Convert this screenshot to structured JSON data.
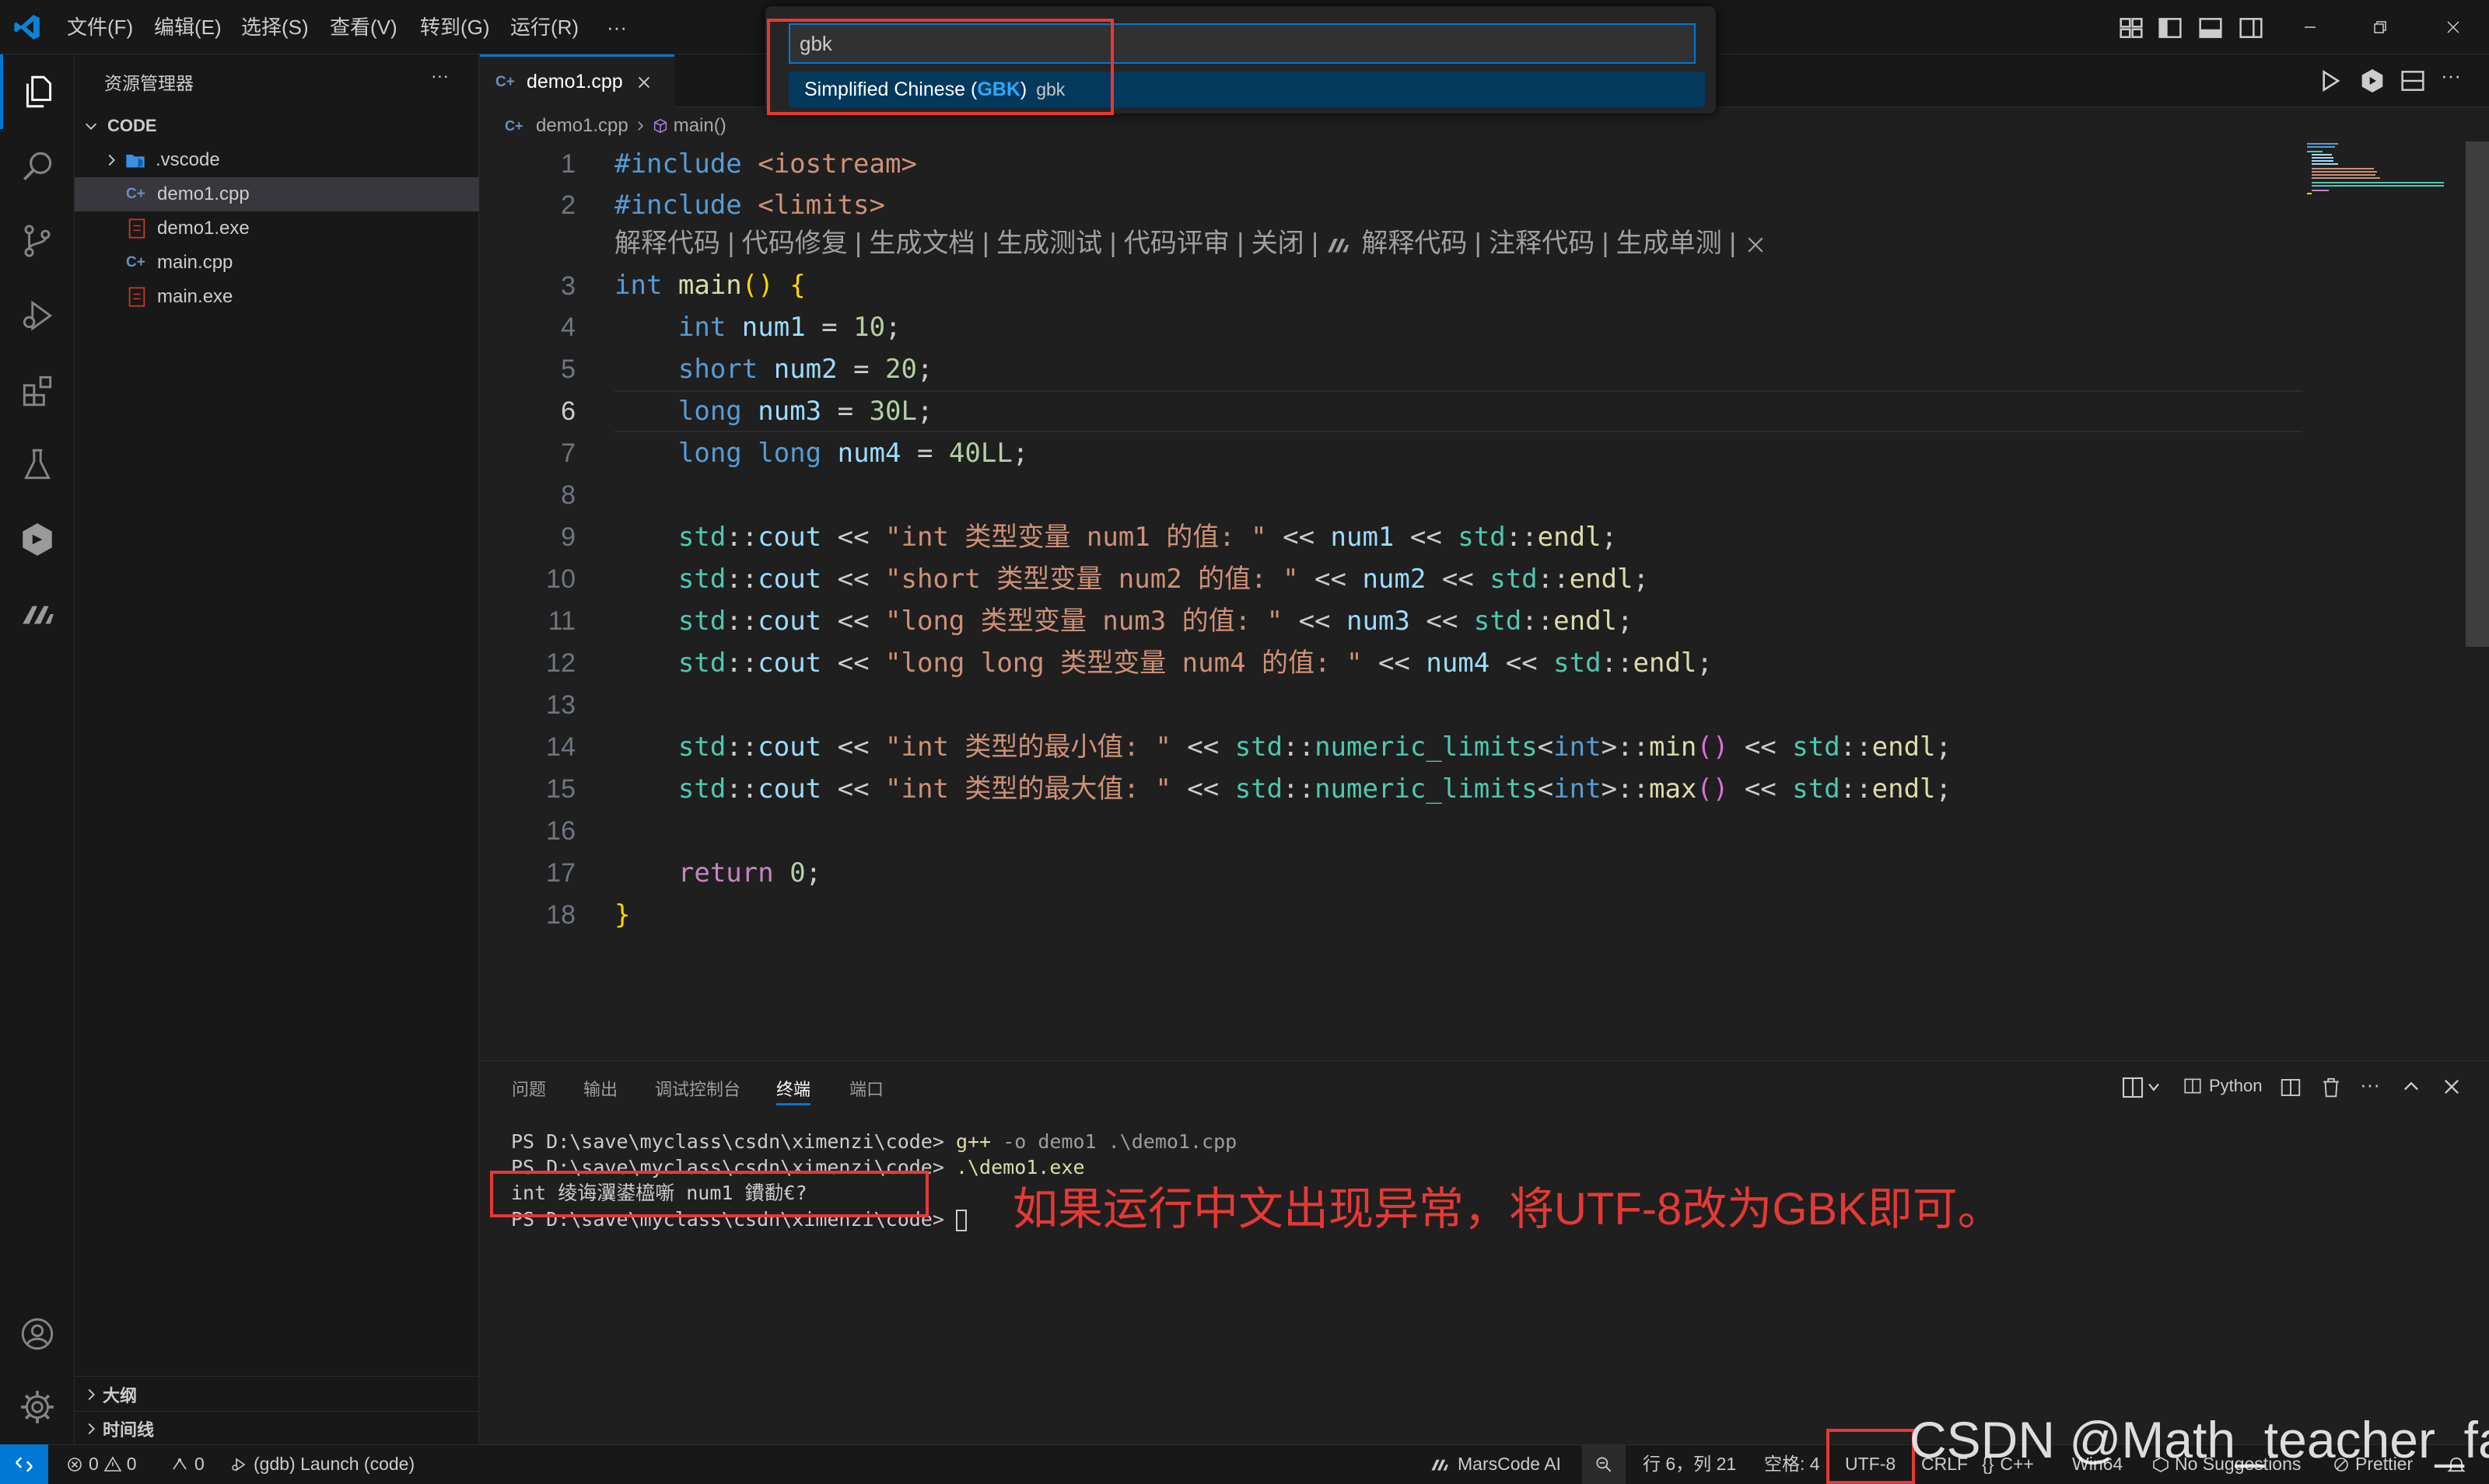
{
  "menu": [
    "文件(F)",
    "编辑(E)",
    "选择(S)",
    "查看(V)",
    "转到(G)",
    "运行(R)",
    "···"
  ],
  "quickpick": {
    "input_value": "gbk",
    "item_prefix": "Simplified Chinese (",
    "item_match": "GBK",
    "item_suffix": ")",
    "item_detail": "gbk"
  },
  "sidebar": {
    "title": "资源管理器",
    "more": "···",
    "folder": "CODE",
    "items": [
      ".vscode",
      "demo1.cpp",
      "demo1.exe",
      "main.cpp",
      "main.exe"
    ],
    "outline": "大纲",
    "timeline": "时间线"
  },
  "tab": {
    "label": "demo1.cpp"
  },
  "breadcrumbs": {
    "file": "demo1.cpp",
    "symbol": "main()"
  },
  "codelens": "解释代码 | 代码修复 | 生成文档 | 生成测试 | 代码评审 | 关闭 | ",
  "codelens2": "解释代码 | 注释代码 | 生成单测 | ",
  "line_numbers": [
    "1",
    "2",
    "3",
    "4",
    "5",
    "6",
    "7",
    "8",
    "9",
    "10",
    "11",
    "12",
    "13",
    "14",
    "15",
    "16",
    "17",
    "18"
  ],
  "panel": {
    "tabs": [
      "问题",
      "输出",
      "调试控制台",
      "终端",
      "端口"
    ],
    "python": "Python",
    "terminal": [
      {
        "prompt": "PS D:\\save\\myclass\\csdn\\ximenzi\\code> ",
        "cmd": "g++",
        "args": " -o demo1 .\\demo1.cpp"
      },
      {
        "prompt": "PS D:\\save\\myclass\\csdn\\ximenzi\\code> ",
        "cmd": ".\\demo1.exe",
        "args": ""
      },
      {
        "prompt": "int 绫诲瀷鍙橀噺 num1 鐨勫€?",
        "cmd": "",
        "args": ""
      },
      {
        "prompt": "PS D:\\save\\myclass\\csdn\\ximenzi\\code> ",
        "cmd": "",
        "args": ""
      }
    ]
  },
  "annotation": "如果运行中文出现异常，将UTF-8改为GBK即可。",
  "statusbar": {
    "errors": "0",
    "warnings": "0",
    "ports": "0",
    "launch": "(gdb) Launch (code)",
    "marscode": "MarsCode AI",
    "position": "行 6，列 21",
    "spaces": "空格: 4",
    "encoding": "UTF-8",
    "eol": "CRLF",
    "language": "C++",
    "platform": "Win64",
    "suggestions": "No Suggestions",
    "prettier": "Prettier"
  },
  "watermark": "CSDN @Math_teacher_fan",
  "colors": {
    "accent": "#0078d4",
    "annotation": "#e53935",
    "background": "#1f1f1f"
  }
}
